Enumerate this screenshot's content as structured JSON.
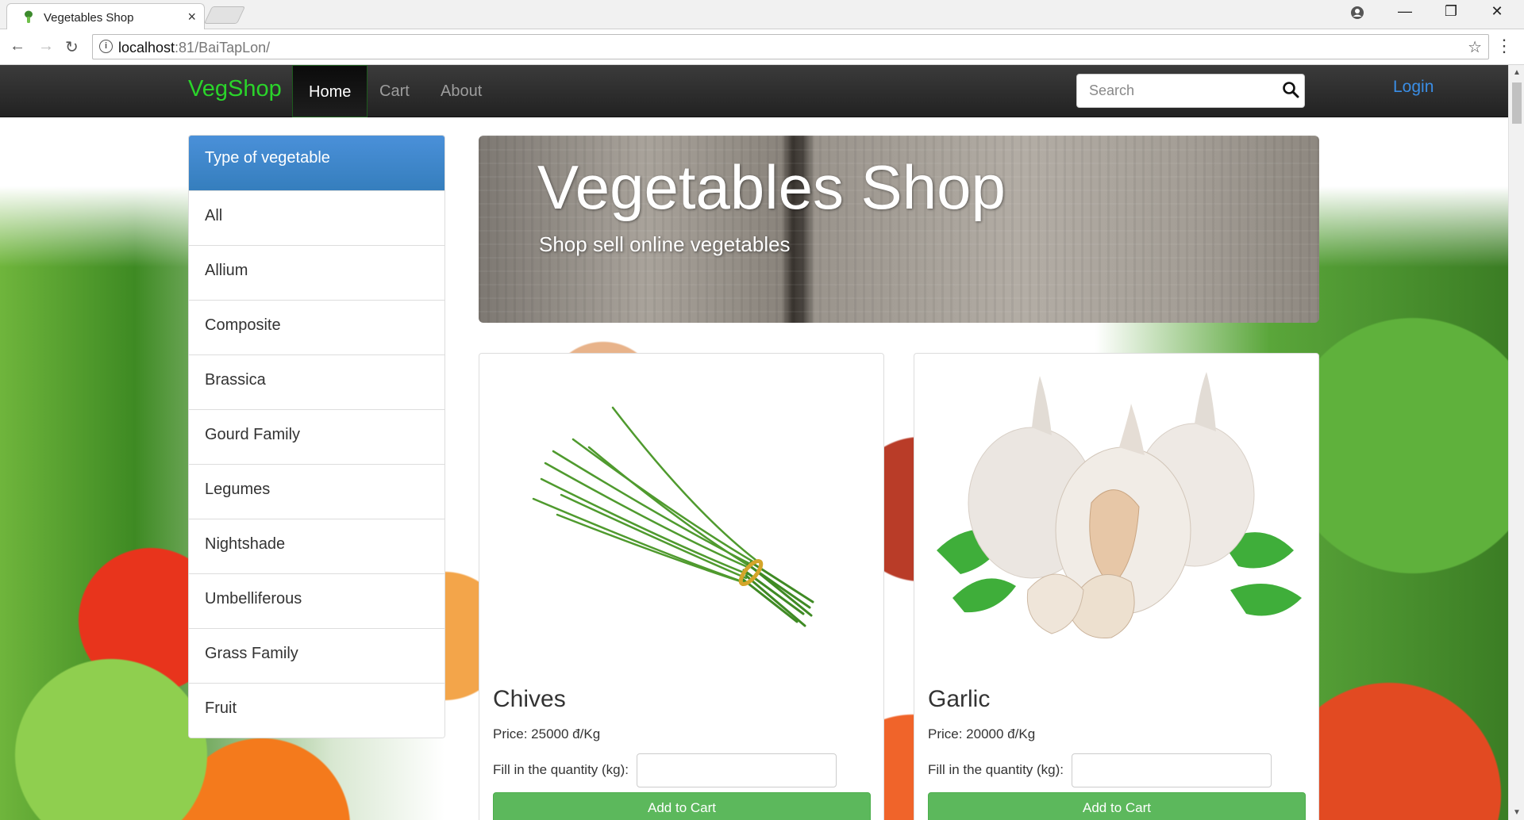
{
  "browser": {
    "tab_title": "Vegetables Shop",
    "tab_close": "×",
    "url_host": "localhost",
    "url_path": ":81/BaiTapLon/"
  },
  "navbar": {
    "brand": "VegShop",
    "items": [
      {
        "label": "Home",
        "active": true
      },
      {
        "label": "Cart",
        "active": false
      },
      {
        "label": "About",
        "active": false
      }
    ],
    "search_placeholder": "Search",
    "login_label": "Login"
  },
  "sidebar": {
    "header": "Type of vegetable",
    "items": [
      {
        "label": "All"
      },
      {
        "label": "Allium"
      },
      {
        "label": "Composite"
      },
      {
        "label": "Brassica"
      },
      {
        "label": "Gourd Family"
      },
      {
        "label": "Legumes"
      },
      {
        "label": "Nightshade"
      },
      {
        "label": "Umbelliferous"
      },
      {
        "label": "Grass Family"
      },
      {
        "label": "Fruit"
      }
    ]
  },
  "jumbotron": {
    "title": "Vegetables Shop",
    "subtitle": "Shop sell online vegetables"
  },
  "products": [
    {
      "name": "Chives",
      "price": "Price: 25000 đ/Kg",
      "qty_label": "Fill in the quantity (kg):",
      "qty_value": "",
      "button": "Add to Cart"
    },
    {
      "name": "Garlic",
      "price": "Price: 20000 đ/Kg",
      "qty_label": "Fill in the quantity (kg):",
      "qty_value": "",
      "button": "Add to Cart"
    }
  ],
  "colors": {
    "brand": "#2ad42a",
    "sidebar_header": "#357ebd",
    "add_to_cart": "#5cb85c",
    "login_link": "#3a8ee6"
  }
}
